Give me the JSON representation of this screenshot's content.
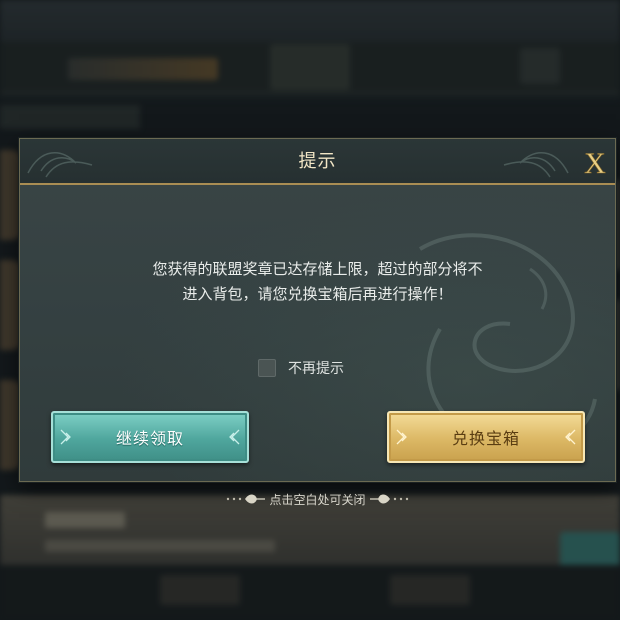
{
  "dialog": {
    "title": "提示",
    "close_glyph": "X",
    "message_line1": "您获得的联盟奖章已达存储上限，超过的部分将不",
    "message_line2": "进入背包，请您兑换宝箱后再进行操作！",
    "checkbox_label": "不再提示",
    "checkbox_checked": false,
    "buttons": {
      "continue_label": "继续领取",
      "exchange_label": "兑换宝箱"
    }
  },
  "hint": {
    "text": "点击空白处可关闭"
  },
  "colors": {
    "accent_gold": "#a98d53",
    "continue_button": "#4fa69d",
    "exchange_button": "#dcb865",
    "title_text": "#f2e6c6"
  },
  "icons": {
    "close": "close-x-icon",
    "button_decor": "arrow-ornament-icon",
    "hint_decor": "fleur-ornament-icon"
  }
}
